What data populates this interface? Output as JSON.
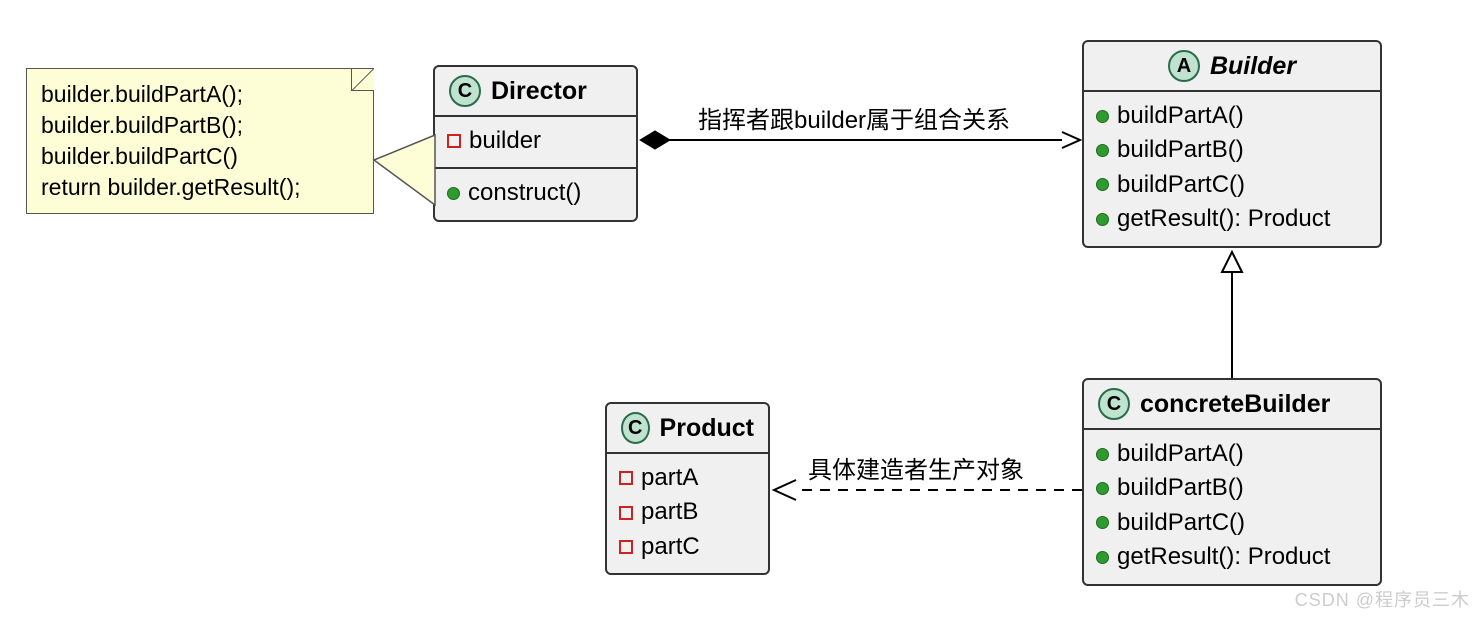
{
  "note": {
    "lines": [
      "builder.buildPartA();",
      "builder.buildPartB();",
      "builder.buildPartC()",
      "return builder.getResult();"
    ]
  },
  "director": {
    "stereotype": "C",
    "name": "Director",
    "attributes": [
      {
        "vis": "private",
        "text": "builder"
      }
    ],
    "methods": [
      {
        "vis": "public",
        "text": "construct()"
      }
    ]
  },
  "builder": {
    "stereotype": "A",
    "name": "Builder",
    "methods": [
      {
        "vis": "public",
        "text": "buildPartA()"
      },
      {
        "vis": "public",
        "text": "buildPartB()"
      },
      {
        "vis": "public",
        "text": "buildPartC()"
      },
      {
        "vis": "public",
        "text": "getResult(): Product"
      }
    ]
  },
  "product": {
    "stereotype": "C",
    "name": "Product",
    "attributes": [
      {
        "vis": "private",
        "text": "partA"
      },
      {
        "vis": "private",
        "text": "partB"
      },
      {
        "vis": "private",
        "text": "partC"
      }
    ]
  },
  "concreteBuilder": {
    "stereotype": "C",
    "name": "concreteBuilder",
    "methods": [
      {
        "vis": "public",
        "text": "buildPartA()"
      },
      {
        "vis": "public",
        "text": "buildPartB()"
      },
      {
        "vis": "public",
        "text": "buildPartC()"
      },
      {
        "vis": "public",
        "text": "getResult(): Product"
      }
    ]
  },
  "labels": {
    "composition": "指挥者跟builder属于组合关系",
    "dependency": "具体建造者生产对象"
  },
  "watermark": "CSDN @程序员三木",
  "chart_data": {
    "type": "uml-class-diagram",
    "classes": [
      {
        "id": "Director",
        "kind": "class",
        "attributes": [
          "- builder"
        ],
        "methods": [
          "+ construct()"
        ]
      },
      {
        "id": "Builder",
        "kind": "abstract",
        "methods": [
          "+ buildPartA()",
          "+ buildPartB()",
          "+ buildPartC()",
          "+ getResult(): Product"
        ]
      },
      {
        "id": "concreteBuilder",
        "kind": "class",
        "methods": [
          "+ buildPartA()",
          "+ buildPartB()",
          "+ buildPartC()",
          "+ getResult(): Product"
        ]
      },
      {
        "id": "Product",
        "kind": "class",
        "attributes": [
          "- partA",
          "- partB",
          "- partC"
        ]
      }
    ],
    "relationships": [
      {
        "from": "Director",
        "to": "Builder",
        "type": "composition",
        "label": "指挥者跟builder属于组合关系"
      },
      {
        "from": "concreteBuilder",
        "to": "Builder",
        "type": "generalization"
      },
      {
        "from": "concreteBuilder",
        "to": "Product",
        "type": "dependency",
        "label": "具体建造者生产对象"
      }
    ],
    "note": {
      "attachedTo": "Director",
      "text": "builder.buildPartA();\nbuilder.buildPartB();\nbuilder.buildPartC()\nreturn builder.getResult();"
    }
  }
}
